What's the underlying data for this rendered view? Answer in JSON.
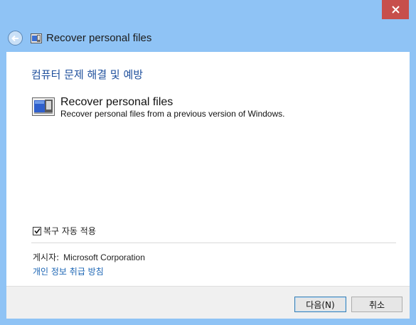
{
  "window": {
    "title": "Recover personal files"
  },
  "icons": {
    "close": "close-icon",
    "back": "back-arrow-icon",
    "app": "troubleshooter-icon",
    "item": "restore-files-icon",
    "check": "checkmark-icon"
  },
  "main": {
    "heading": "컴퓨터 문제 해결 및 예방",
    "item": {
      "title": "Recover personal files",
      "description": "Recover personal files from a previous version of Windows."
    },
    "auto_repair": {
      "label": "복구 자동 적용",
      "checked": true
    },
    "publisher": {
      "label": "게시자:",
      "value": "Microsoft Corporation"
    },
    "privacy_link": "개인 정보 취급 방침"
  },
  "footer": {
    "next_label": "다음(N)",
    "cancel_label": "취소"
  },
  "colors": {
    "frame": "#8fc3f5",
    "close": "#c74f4c",
    "heading": "#1e4f9c",
    "link": "#1a64b4"
  }
}
